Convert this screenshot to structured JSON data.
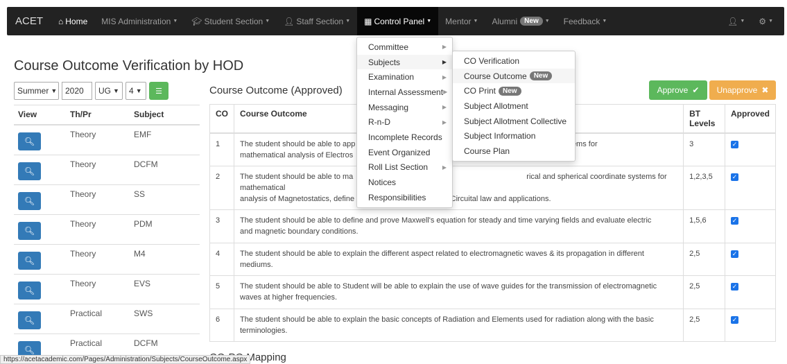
{
  "nav": {
    "brand": "ACET",
    "items": [
      {
        "label": "Home",
        "icon": "home-icon"
      },
      {
        "label": "MIS Administration"
      },
      {
        "label": "Student Section",
        "icon": "graduation-cap-icon"
      },
      {
        "label": "Staff Section",
        "icon": "user-icon"
      },
      {
        "label": "Control Panel",
        "icon": "grid-icon"
      },
      {
        "label": "Mentor"
      },
      {
        "label": "Alumni",
        "badge": "New"
      },
      {
        "label": "Feedback"
      }
    ],
    "right_icons": [
      "user-icon",
      "gear-icon"
    ]
  },
  "page": {
    "title": "Course Outcome Verification by HOD",
    "filters": {
      "session": "Summer",
      "year": "2020",
      "level": "UG",
      "sem": "4"
    }
  },
  "left_table": {
    "headers": [
      "View",
      "Th/Pr",
      "Subject"
    ],
    "rows": [
      {
        "type": "Theory",
        "subject": "EMF"
      },
      {
        "type": "Theory",
        "subject": "DCFM"
      },
      {
        "type": "Theory",
        "subject": "SS"
      },
      {
        "type": "Theory",
        "subject": "PDM"
      },
      {
        "type": "Theory",
        "subject": "M4"
      },
      {
        "type": "Theory",
        "subject": "EVS"
      },
      {
        "type": "Practical",
        "subject": "SWS"
      },
      {
        "type": "Practical",
        "subject": "DCFM"
      }
    ]
  },
  "co_section": {
    "title": "Course Outcome (Approved)",
    "approve_label": "Approve",
    "unapprove_label": "Unapprove",
    "headers": {
      "co": "CO",
      "outcome": "Course Outcome",
      "bt": "BT Levels",
      "approved": "Approved"
    },
    "rows": [
      {
        "co": "1",
        "text": "The student should be able to app… ordinate systems for mathematical analysis of Electros…",
        "line1": "The student should be able to app",
        "line1b": "dinate systems for",
        "line2": "mathematical analysis of Electros",
        "bt": "3"
      },
      {
        "co": "2",
        "line1": "The student should be able to ma",
        "line1b": "rical and spherical coordinate systems for mathematical",
        "line2": "analysis of Magnetostatics, define",
        "line2b": "aw, Ampere Circuital law and applications.",
        "bt": "1,2,3,5"
      },
      {
        "co": "3",
        "line1": "The student should be able to define and prove Maxwell's equation for steady and time varying fields and evaluate electric",
        "line2": "and magnetic boundary conditions.",
        "bt": "1,5,6"
      },
      {
        "co": "4",
        "line1": "The student should be able to explain the different aspect related to electromagnetic waves & its propagation in different",
        "line2": "mediums.",
        "bt": "2,5"
      },
      {
        "co": "5",
        "line1": "The student should be able to Student will be able to explain the use of wave guides for the transmission of electromagnetic",
        "line2": "waves at higher frequencies.",
        "bt": "2,5"
      },
      {
        "co": "6",
        "line1": "The student should be able to explain the basic concepts of Radiation and Elements used for radiation along with the basic",
        "line2": "terminologies.",
        "bt": "2,5"
      }
    ]
  },
  "section2_title": "CO-PO Mapping",
  "status_url": "https://acetacademic.com/Pages/Administration/Subjects/CourseOutcome.aspx",
  "control_panel_menu": [
    {
      "label": "Committee",
      "sub": true
    },
    {
      "label": "Subjects",
      "sub": true
    },
    {
      "label": "Examination",
      "sub": true
    },
    {
      "label": "Internal Assessment",
      "sub": true
    },
    {
      "label": "Messaging",
      "sub": true
    },
    {
      "label": "R-n-D",
      "sub": true
    },
    {
      "label": "Incomplete Records",
      "sub": false
    },
    {
      "label": "Event Organized",
      "sub": false
    },
    {
      "label": "Roll List Section",
      "sub": true
    },
    {
      "label": "Notices",
      "sub": false
    },
    {
      "label": "Responsibilities",
      "sub": false
    }
  ],
  "subjects_menu": [
    {
      "label": "CO Verification"
    },
    {
      "label": "Course Outcome",
      "badge": "New"
    },
    {
      "label": "CO Print",
      "badge": "New"
    },
    {
      "label": "Subject Allotment"
    },
    {
      "label": "Subject Allotment Collective"
    },
    {
      "label": "Subject Information"
    },
    {
      "label": "Course Plan"
    }
  ],
  "colors": {
    "navbar": "#222222",
    "primary": "#337ab7",
    "success": "#5cb85c",
    "warning": "#f0ad4e",
    "badge": "#777777"
  }
}
